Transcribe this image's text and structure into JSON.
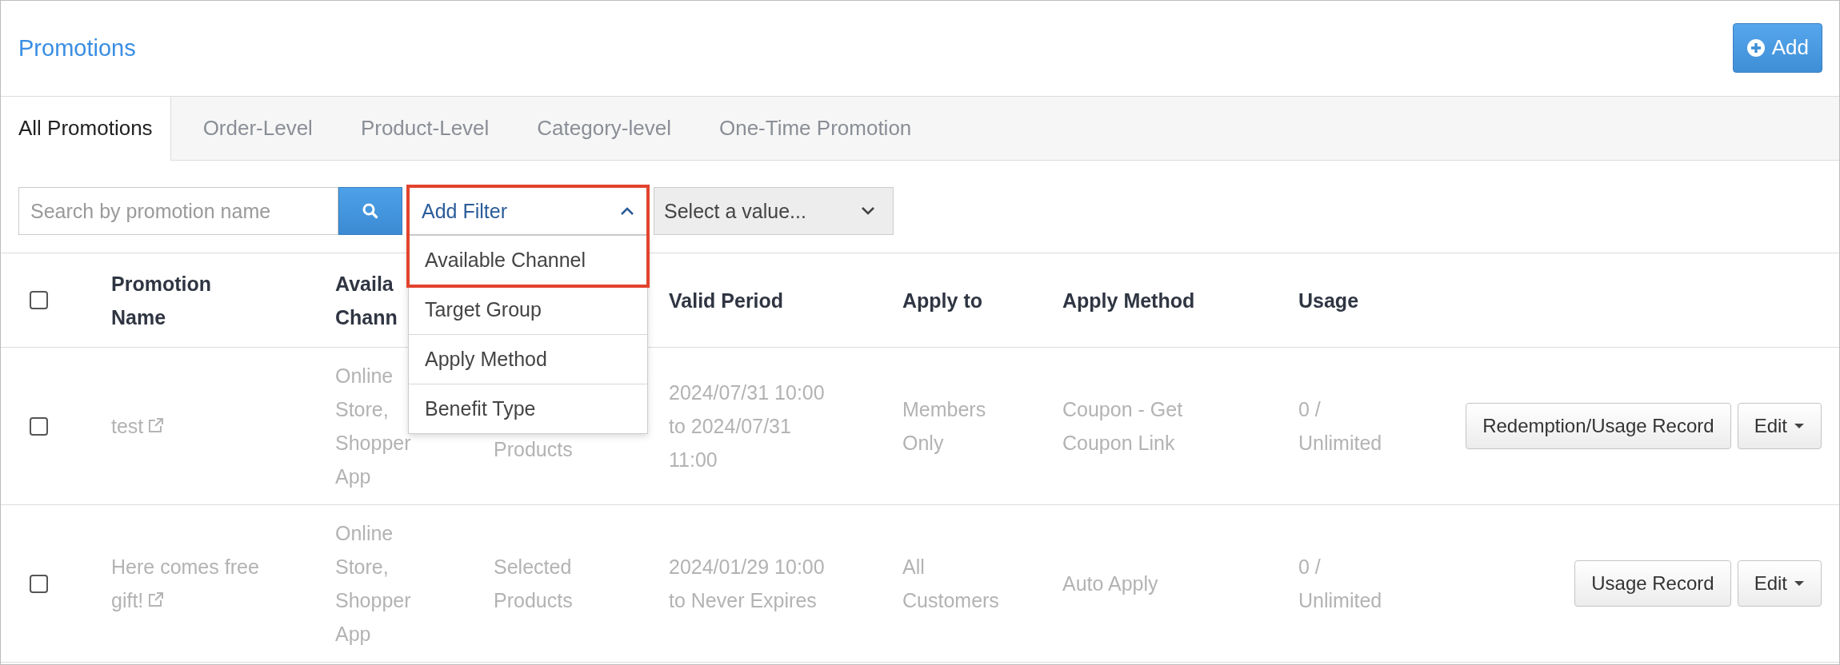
{
  "page": {
    "title": "Promotions",
    "add_button": "Add"
  },
  "tabs": [
    {
      "label": "All Promotions",
      "selected": true
    },
    {
      "label": "Order-Level",
      "selected": false
    },
    {
      "label": "Product-Level",
      "selected": false
    },
    {
      "label": "Category-level",
      "selected": false
    },
    {
      "label": "One-Time Promotion",
      "selected": false
    }
  ],
  "filters": {
    "search": {
      "placeholder": "Search by promotion name"
    },
    "add_filter": {
      "label": "Add Filter",
      "expanded": true,
      "highlighted": true,
      "options": [
        "Available Channel",
        "Target Group",
        "Apply Method",
        "Benefit Type"
      ]
    },
    "value_select": {
      "placeholder": "Select a value..."
    }
  },
  "table": {
    "select_all_checked": false,
    "columns": [
      "Promotion Name",
      "Availa Chann",
      "Valid Period",
      "Apply to",
      "Apply Method",
      "Usage"
    ],
    "rows": [
      {
        "checked": false,
        "promotion_name": "test",
        "available_channel": "Online Store, Shopper App",
        "column_3": {
          "text": "Products",
          "clipped": true
        },
        "valid_period": "2024/07/31 10:00 to 2024/07/31 11:00",
        "apply_to": "Members Only",
        "apply_method": "Coupon - Get Coupon Link",
        "usage": "0 / Unlimited",
        "actions": [
          {
            "label": "Redemption/Usage Record",
            "kind": "button"
          },
          {
            "label": "Edit",
            "kind": "dropdown"
          }
        ]
      },
      {
        "checked": false,
        "promotion_name": "Here comes free gift!",
        "available_channel": "Online Store, Shopper App",
        "column_3": {
          "text": "Selected Products",
          "clipped": false
        },
        "valid_period": "2024/01/29 10:00 to Never Expires",
        "apply_to": "All Customers",
        "apply_method": "Auto Apply",
        "usage": "0 / Unlimited",
        "actions": [
          {
            "label": "Usage Record",
            "kind": "button"
          },
          {
            "label": "Edit",
            "kind": "dropdown"
          }
        ]
      }
    ]
  }
}
